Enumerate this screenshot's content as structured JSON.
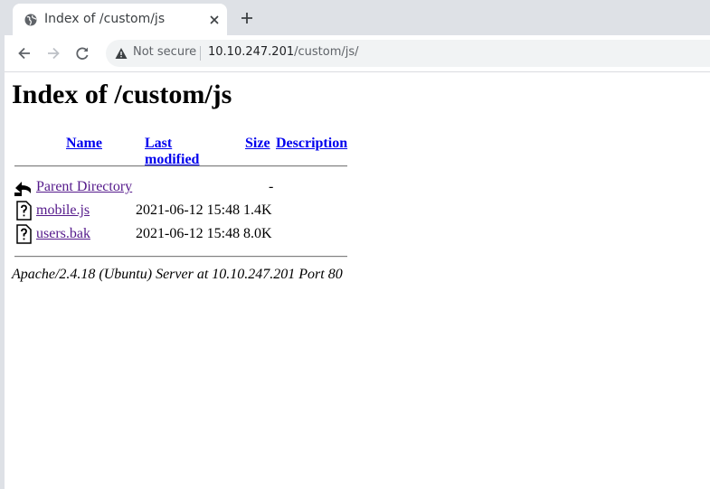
{
  "browser": {
    "tab_title": "Index of /custom/js",
    "omnibox": {
      "security_label": "Not secure",
      "url_host": "10.10.247.201",
      "url_path": "/custom/js/"
    }
  },
  "page": {
    "heading": "Index of /custom/js",
    "columns": {
      "name": "Name",
      "last_modified": "Last modified",
      "size": "Size",
      "description": "Description"
    },
    "parent": {
      "name": "Parent Directory",
      "size": "-"
    },
    "files": [
      {
        "name": "mobile.js",
        "last_modified": "2021-06-12 15:48",
        "size": "1.4K"
      },
      {
        "name": "users.bak",
        "last_modified": "2021-06-12 15:48",
        "size": "8.0K"
      }
    ],
    "server_signature": "Apache/2.4.18 (Ubuntu) Server at 10.10.247.201 Port 80"
  }
}
